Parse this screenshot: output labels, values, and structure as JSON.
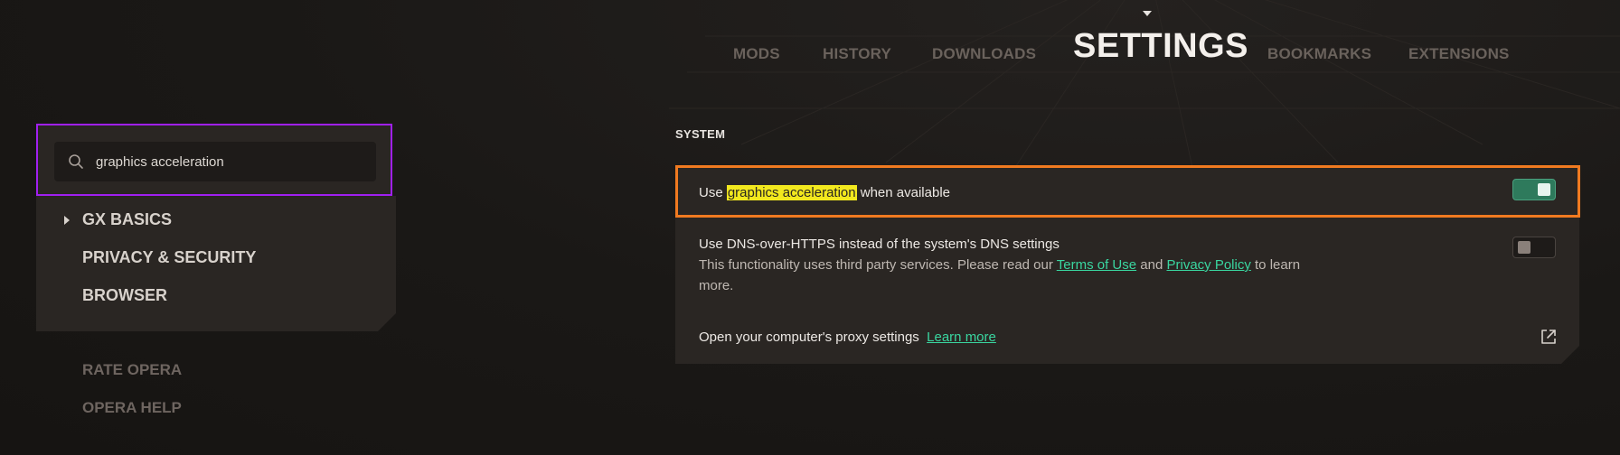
{
  "nav": {
    "tabs": [
      {
        "label": "MODS"
      },
      {
        "label": "HISTORY"
      },
      {
        "label": "DOWNLOADS"
      },
      {
        "label": "SETTINGS"
      },
      {
        "label": "BOOKMARKS"
      },
      {
        "label": "EXTENSIONS"
      }
    ],
    "active": "SETTINGS"
  },
  "search": {
    "value": "graphics acceleration",
    "icon": "search-icon"
  },
  "sidebar": {
    "items": [
      {
        "label": "GX BASICS"
      },
      {
        "label": "PRIVACY & SECURITY"
      },
      {
        "label": "BROWSER"
      }
    ],
    "footer": [
      {
        "label": "RATE OPERA"
      },
      {
        "label": "OPERA HELP"
      }
    ]
  },
  "section": {
    "title": "SYSTEM",
    "settings": [
      {
        "prefix": "Use ",
        "highlight": "graphics acceleration",
        "suffix": " when available",
        "enabled": true
      },
      {
        "label": "Use DNS-over-HTTPS instead of the system's DNS settings",
        "desc_part1": "This functionality uses third party services. Please read our ",
        "link1": "Terms of Use",
        "desc_and": " and ",
        "link2": "Privacy Policy",
        "desc_part2": " to learn more.",
        "enabled": false
      },
      {
        "label": "Open your computer's proxy settings",
        "link": "Learn more",
        "icon": "external-link-icon"
      }
    ]
  },
  "colors": {
    "accent_green": "#3ad6a0",
    "highlight_yellow": "#f2e81e",
    "search_border": "#a020f0",
    "row_border": "#f07a20"
  }
}
